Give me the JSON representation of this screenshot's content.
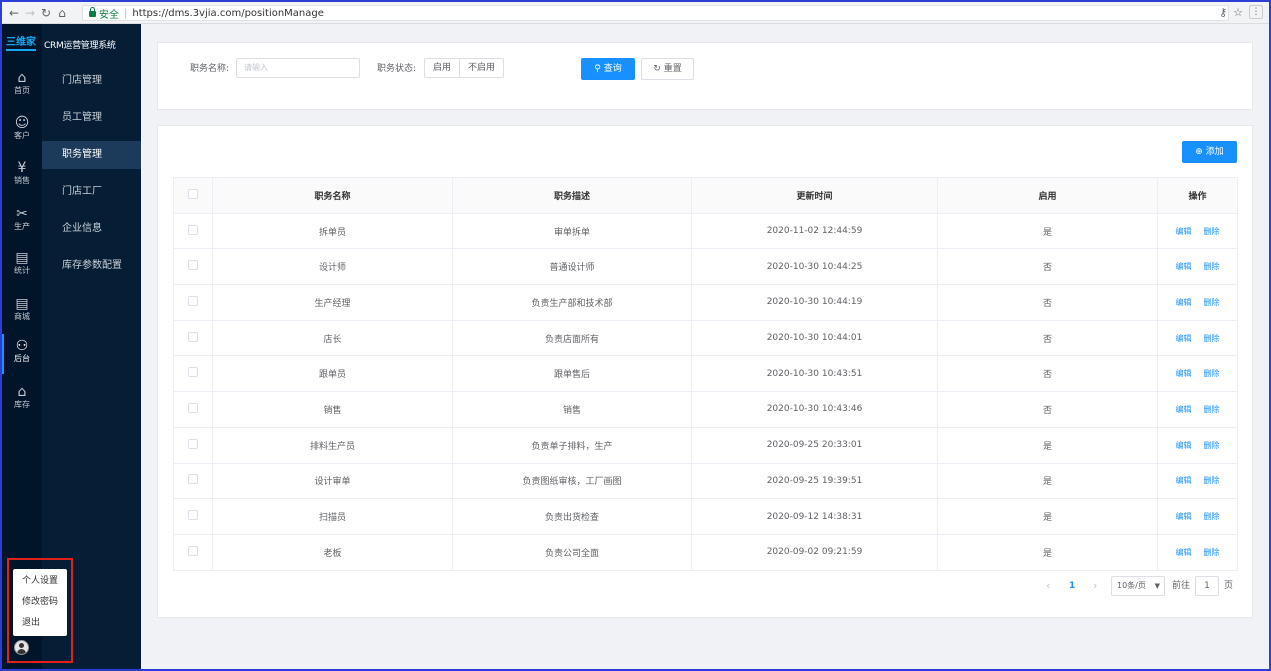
{
  "browser": {
    "secure_label": "安全",
    "url": "https://dms.3vjia.com/positionManage"
  },
  "logo": {
    "mark": "三维家",
    "title": "CRM运营管理系统"
  },
  "iconnav": [
    {
      "label": "首页",
      "icon": "home-icon",
      "glyph": "⌂"
    },
    {
      "label": "客户",
      "icon": "users-icon",
      "glyph": "☺"
    },
    {
      "label": "销售",
      "icon": "yen-icon",
      "glyph": "¥"
    },
    {
      "label": "生产",
      "icon": "tools-icon",
      "glyph": "✂"
    },
    {
      "label": "统计",
      "icon": "document-icon",
      "glyph": "▤"
    },
    {
      "label": "商城",
      "icon": "document-icon",
      "glyph": "▤"
    },
    {
      "label": "后台",
      "icon": "admin-icon",
      "glyph": "⚇"
    },
    {
      "label": "库存",
      "icon": "warehouse-icon",
      "glyph": "⌂"
    }
  ],
  "subnav": [
    "门店管理",
    "员工管理",
    "职务管理",
    "门店工厂",
    "企业信息",
    "库存参数配置"
  ],
  "user_menu": [
    "个人设置",
    "修改密码",
    "退出"
  ],
  "search": {
    "name_label": "职务名称:",
    "name_placeholder": "请输入",
    "status_label": "职务状态:",
    "status_options": [
      "启用",
      "不启用"
    ],
    "query_button": "查询",
    "reset_button": "重置"
  },
  "add_button": "添加",
  "table": {
    "columns": [
      "职务名称",
      "职务描述",
      "更新时间",
      "启用",
      "操作"
    ],
    "edit_label": "编辑",
    "delete_label": "删除",
    "rows": [
      {
        "name": "拆单员",
        "desc": "审单拆单",
        "time": "2020-11-02 12:44:59",
        "enabled": "是"
      },
      {
        "name": "设计师",
        "desc": "普通设计师",
        "time": "2020-10-30 10:44:25",
        "enabled": "否"
      },
      {
        "name": "生产经理",
        "desc": "负责生产部和技术部",
        "time": "2020-10-30 10:44:19",
        "enabled": "否"
      },
      {
        "name": "店长",
        "desc": "负责店面所有",
        "time": "2020-10-30 10:44:01",
        "enabled": "否"
      },
      {
        "name": "跟单员",
        "desc": "跟单售后",
        "time": "2020-10-30 10:43:51",
        "enabled": "否"
      },
      {
        "name": "销售",
        "desc": "销售",
        "time": "2020-10-30 10:43:46",
        "enabled": "否"
      },
      {
        "name": "排料生产员",
        "desc": "负责单子排料，生产",
        "time": "2020-09-25 20:33:01",
        "enabled": "是"
      },
      {
        "name": "设计审单",
        "desc": "负责图纸审核，工厂画图",
        "time": "2020-09-25 19:39:51",
        "enabled": "是"
      },
      {
        "name": "扫描员",
        "desc": "负责出货检查",
        "time": "2020-09-12 14:38:31",
        "enabled": "是"
      },
      {
        "name": "老板",
        "desc": "负责公司全面",
        "time": "2020-09-02 09:21:59",
        "enabled": "是"
      }
    ]
  },
  "pagination": {
    "current_page": "1",
    "page_size": "10条/页",
    "goto_label": "前往",
    "goto_value": "1",
    "page_unit": "页"
  }
}
